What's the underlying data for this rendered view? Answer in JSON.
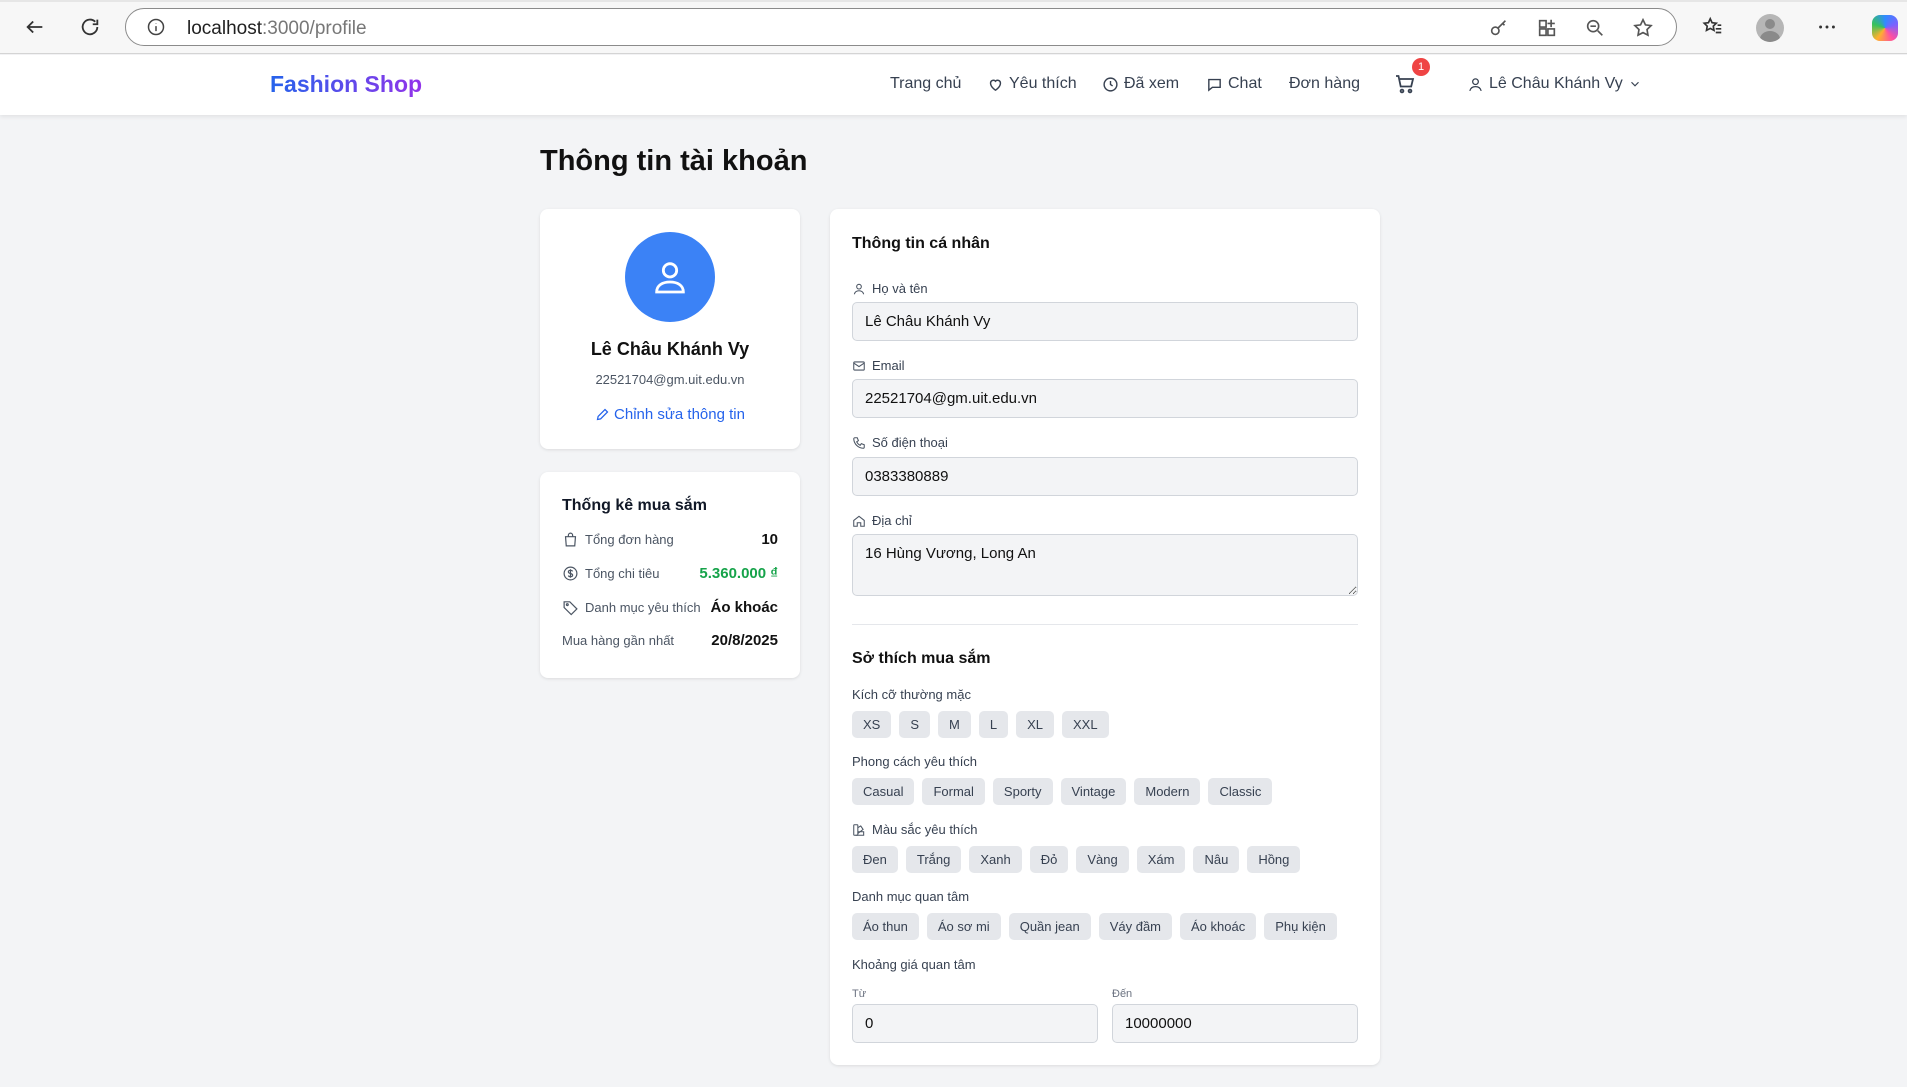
{
  "browser": {
    "url_host": "localhost",
    "url_path": ":3000/profile"
  },
  "navbar": {
    "brand": "Fashion Shop",
    "items": [
      {
        "label": "Trang chủ",
        "icon": "none"
      },
      {
        "label": "Yêu thích",
        "icon": "heart-icon"
      },
      {
        "label": "Đã xem",
        "icon": "clock-icon"
      },
      {
        "label": "Chat",
        "icon": "chat-icon"
      },
      {
        "label": "Đơn hàng",
        "icon": "none"
      }
    ],
    "cart_count": "1",
    "user_name": "Lê Châu Khánh Vy"
  },
  "page": {
    "title": "Thông tin tài khoản"
  },
  "profile_card": {
    "name": "Lê Châu Khánh Vy",
    "email": "22521704@gm.uit.edu.vn",
    "edit_label": "Chỉnh sửa thông tin"
  },
  "stats": {
    "title": "Thống kê mua sắm",
    "total_orders_label": "Tổng đơn hàng",
    "total_orders_value": "10",
    "total_spent_label": "Tổng chi tiêu",
    "total_spent_value": "5.360.000 ₫",
    "favorite_category_label": "Danh mục yêu thích",
    "favorite_category_value": "Áo khoác",
    "last_purchase_label": "Mua hàng gần nhất",
    "last_purchase_value": "20/8/2025"
  },
  "personal": {
    "title": "Thông tin cá nhân",
    "name_label": "Họ và tên",
    "name_value": "Lê Châu Khánh Vy",
    "email_label": "Email",
    "email_value": "22521704@gm.uit.edu.vn",
    "phone_label": "Số điện thoại",
    "phone_value": "0383380889",
    "address_label": "Địa chỉ",
    "address_value": "16 Hùng Vương, Long An"
  },
  "preferences": {
    "title": "Sở thích mua sắm",
    "size_label": "Kích cỡ thường mặc",
    "sizes": [
      "XS",
      "S",
      "M",
      "L",
      "XL",
      "XXL"
    ],
    "style_label": "Phong cách yêu thích",
    "styles": [
      "Casual",
      "Formal",
      "Sporty",
      "Vintage",
      "Modern",
      "Classic"
    ],
    "color_label": "Màu sắc yêu thích",
    "colors": [
      "Đen",
      "Trắng",
      "Xanh",
      "Đỏ",
      "Vàng",
      "Xám",
      "Nâu",
      "Hồng"
    ],
    "category_label": "Danh mục quan tâm",
    "categories": [
      "Áo thun",
      "Áo sơ mi",
      "Quần jean",
      "Váy đầm",
      "Áo khoác",
      "Phụ kiện"
    ],
    "price_label": "Khoảng giá quan tâm",
    "price_from_label": "Từ",
    "price_from_value": "0",
    "price_to_label": "Đến",
    "price_to_value": "10000000"
  }
}
